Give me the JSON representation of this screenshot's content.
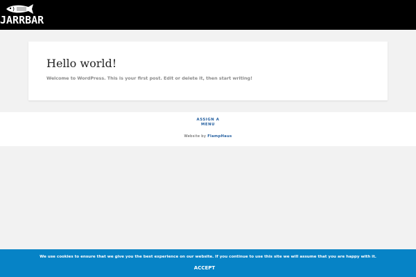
{
  "header": {
    "logo_text": "JARRBAR",
    "logo_icon": "fish-icon",
    "background_color": "#000000"
  },
  "post": {
    "title": "Hello world!",
    "excerpt": "Welcome to WordPress. This is your first post. Edit or delete it, then start writing!"
  },
  "footer": {
    "menu_line1": "ASSIGN A",
    "menu_line2": "MENU",
    "credit_prefix": "Website by ",
    "credit_link": "FlampHaus"
  },
  "cookie_notice": {
    "text": "We use cookies to ensure that we give you the best experience on our website. If you continue to use this site we will assume that you are happy with it.",
    "accept_label": "ACCEPT",
    "background_color": "#0683c6"
  },
  "colors": {
    "page_background": "#f2f2f2",
    "link_blue": "#1f5c9e"
  }
}
